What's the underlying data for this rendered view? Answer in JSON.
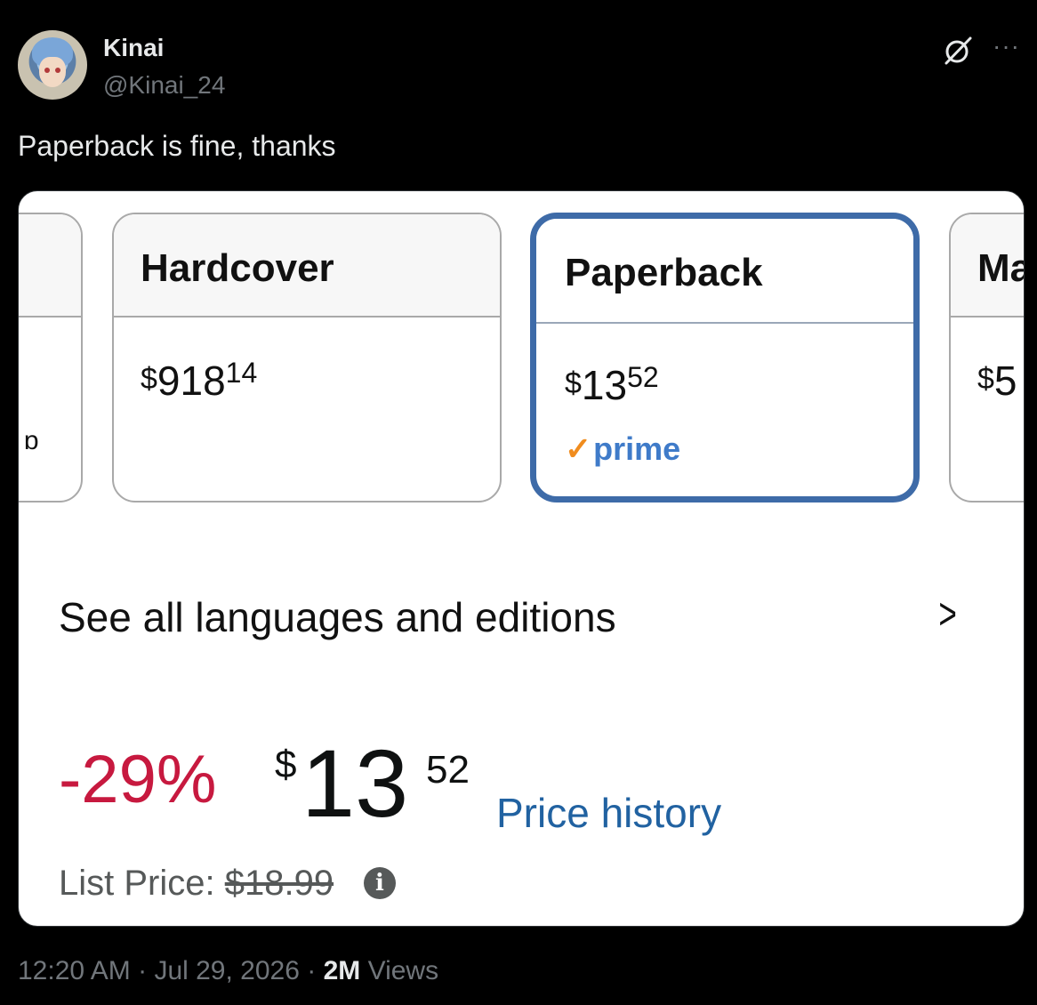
{
  "author": {
    "name": "Kinai",
    "handle": "@Kinai_24"
  },
  "tweet": {
    "text": "Paperback is fine, thanks"
  },
  "card": {
    "left_fragment": "ɒ",
    "options": {
      "hardcover": {
        "format": "Hardcover",
        "currency": "$",
        "whole": "918",
        "cents": "14"
      },
      "paperback": {
        "format": "Paperback",
        "currency": "$",
        "whole": "13",
        "cents": "52",
        "badge": "prime"
      },
      "partial": {
        "format": "Ma",
        "currency": "$",
        "whole": "5"
      }
    },
    "editions_link": "See all languages and editions",
    "discount": "-29%",
    "price": {
      "currency": "$",
      "whole": "13",
      "cents": "52"
    },
    "price_history": "Price history",
    "list_price_label": "List Price:",
    "list_price_value": "$18.99",
    "colors": {
      "selected_border": "#3e6ba8",
      "discount": "#c7193f",
      "link": "#2162a1",
      "prime": "#3f7bc9"
    }
  },
  "meta": {
    "time": "12:20 AM",
    "date": "Jul 29, 2026",
    "views_count": "2M",
    "views_label": "Views"
  }
}
